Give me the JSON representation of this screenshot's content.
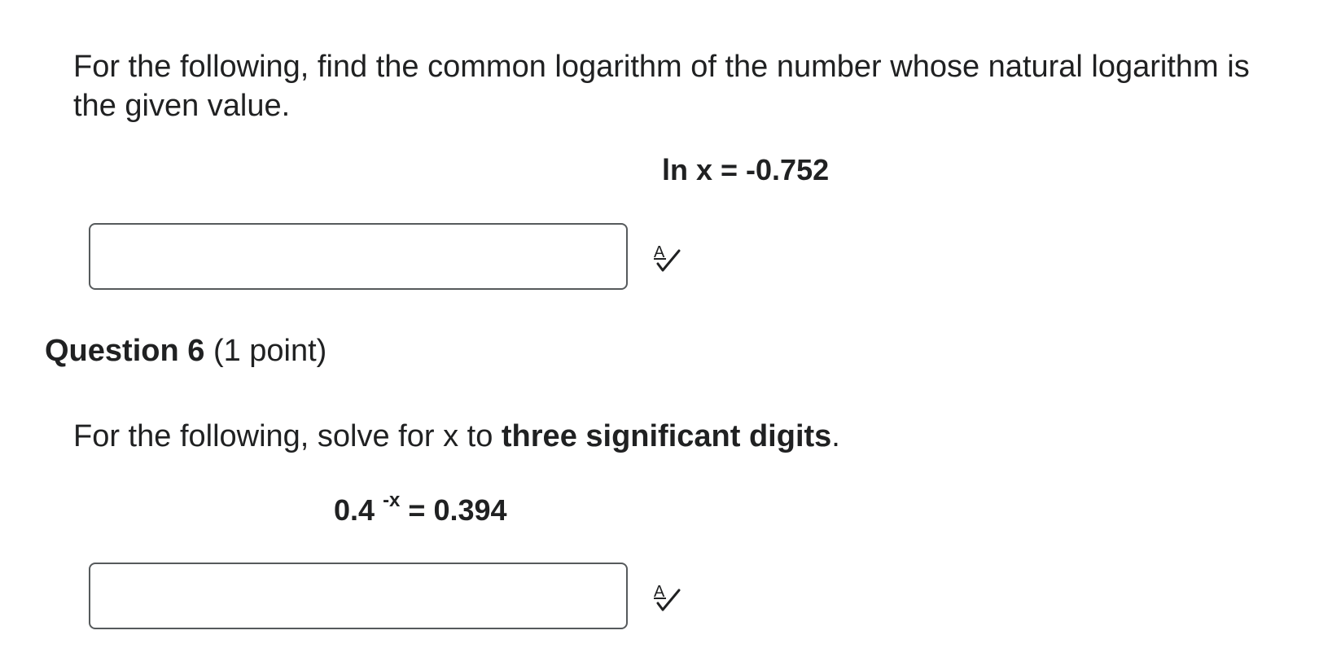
{
  "question5": {
    "prompt": "For the following, find the common logarithm of the number whose natural logarithm is the given value.",
    "equation": "ln x = -0.752",
    "answer_value": "",
    "spellcheck_icon": "spell-check-icon"
  },
  "question6": {
    "title": "Question 6",
    "points": "(1 point)",
    "prompt_before": "For the following, solve for x to ",
    "prompt_emphasis": "three significant digits",
    "prompt_after": ".",
    "equation_base": "0.4",
    "equation_exponent": "-x",
    "equation_rest": "= 0.394",
    "answer_value": "",
    "spellcheck_icon": "spell-check-icon"
  },
  "colors": {
    "text": "#202122",
    "input_border": "#565a5c",
    "background": "#ffffff"
  }
}
